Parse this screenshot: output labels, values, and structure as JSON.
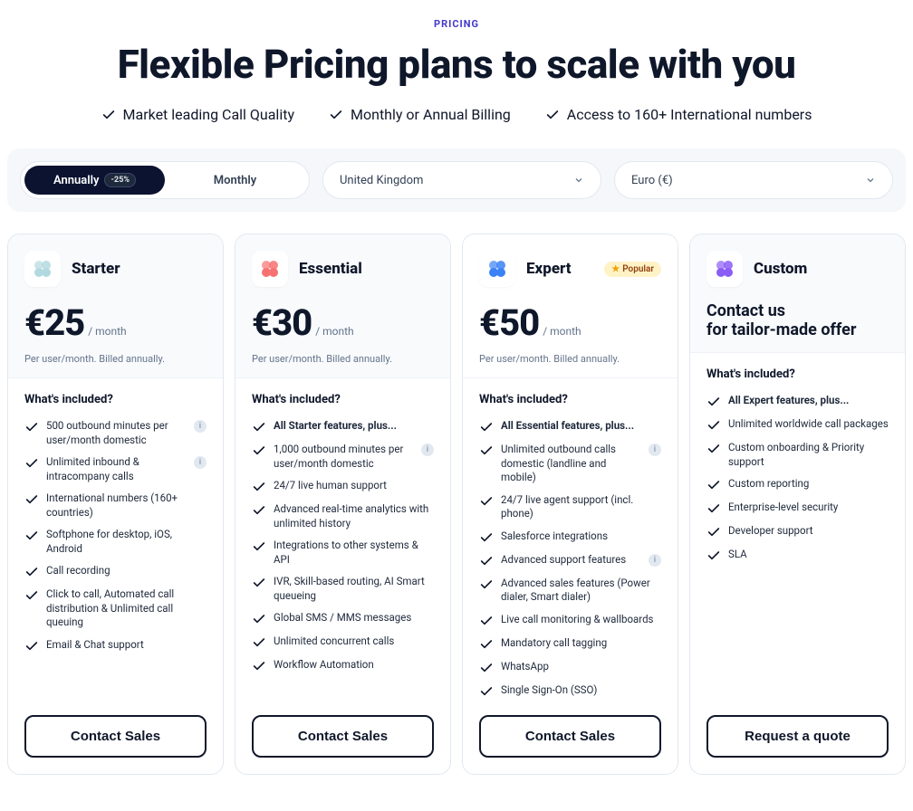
{
  "eyebrow": "PRICING",
  "title": "Flexible Pricing plans to scale with you",
  "benefits": [
    "Market leading Call Quality",
    "Monthly or Annual Billing",
    "Access to 160+ International numbers"
  ],
  "toggle": {
    "annually": "Annually",
    "discount": "-25%",
    "monthly": "Monthly"
  },
  "country": "United Kingdom",
  "currency": "Euro (€)",
  "popular_label": "Popular",
  "included_label": "What's included?",
  "bill_note": "Per user/month. Billed annually.",
  "per_month": "/ month",
  "plans": [
    {
      "name": "Starter",
      "price": "€25",
      "cta": "Contact Sales",
      "features": [
        {
          "text": "500 outbound minutes per user/month domestic",
          "info": true
        },
        {
          "text": "Unlimited inbound & intracompany calls",
          "info": true
        },
        {
          "text": "International numbers (160+ countries)"
        },
        {
          "text": "Softphone for desktop, iOS, Android"
        },
        {
          "text": "Call recording"
        },
        {
          "text": "Click to call, Automated call distribution & Unlimited call queuing"
        },
        {
          "text": "Email & Chat support"
        }
      ]
    },
    {
      "name": "Essential",
      "price": "€30",
      "cta": "Contact Sales",
      "lead": "All Starter features, plus...",
      "features": [
        {
          "text": "1,000 outbound minutes per user/month domestic",
          "info": true
        },
        {
          "text": "24/7 live human support"
        },
        {
          "text": "Advanced real-time analytics with unlimited history"
        },
        {
          "text": "Integrations to other systems & API"
        },
        {
          "text": "IVR, Skill-based routing, AI Smart queueing"
        },
        {
          "text": "Global SMS / MMS messages"
        },
        {
          "text": "Unlimited concurrent calls"
        },
        {
          "text": "Workflow Automation"
        }
      ]
    },
    {
      "name": "Expert",
      "price": "€50",
      "popular": true,
      "cta": "Contact Sales",
      "lead": "All Essential features, plus...",
      "features": [
        {
          "text": "Unlimited outbound calls domestic (landline and mobile)",
          "info": true
        },
        {
          "text": "24/7 live agent support (incl. phone)"
        },
        {
          "text": "Salesforce integrations"
        },
        {
          "text": "Advanced support features",
          "info": true
        },
        {
          "text": "Advanced sales features (Power dialer, Smart dialer)"
        },
        {
          "text": "Live call monitoring & wallboards"
        },
        {
          "text": "Mandatory call tagging"
        },
        {
          "text": "WhatsApp"
        },
        {
          "text": "Single Sign-On (SSO)"
        }
      ]
    },
    {
      "name": "Custom",
      "custom_line1": "Contact us",
      "custom_line2": "for tailor-made offer",
      "cta": "Request a quote",
      "lead": "All Expert features, plus...",
      "features": [
        {
          "text": "Unlimited worldwide call packages"
        },
        {
          "text": "Custom onboarding & Priority support"
        },
        {
          "text": "Custom reporting"
        },
        {
          "text": "Enterprise-level security"
        },
        {
          "text": "Developer support"
        },
        {
          "text": "SLA"
        }
      ]
    }
  ],
  "icon_colors": [
    "#b3d9e0",
    "#f87171",
    "#3b82f6",
    "#8b5cf6"
  ]
}
